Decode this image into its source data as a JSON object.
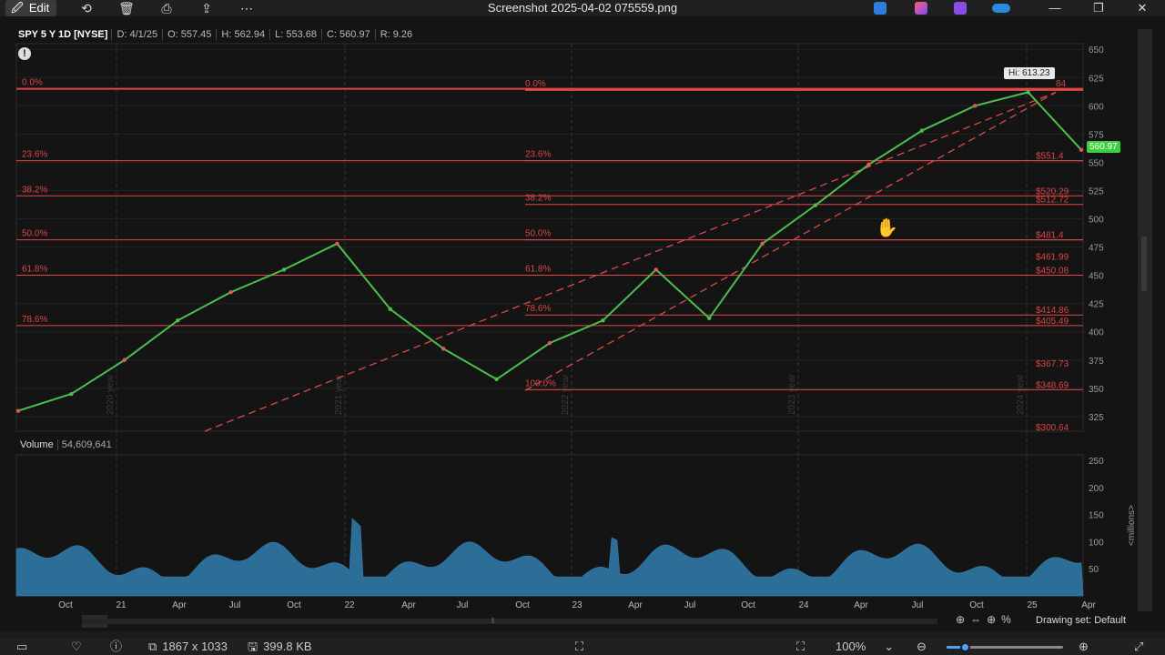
{
  "titlebar": {
    "edit_label": "Edit",
    "title": "Screenshot 2025-04-02 075559.png",
    "minimize": "—",
    "restore": "❐",
    "close": "✕"
  },
  "chart": {
    "header": {
      "symbol": "SPY 5 Y 1D [NYSE]",
      "date": "D: 4/1/25",
      "open": "O: 557.45",
      "high": "H: 562.94",
      "low": "L: 553.68",
      "close": "C: 560.97",
      "range": "R: 9.26"
    },
    "hi_tag": "Hi: 613.23",
    "last_tag": "560.97",
    "volume_label": "Volume",
    "volume_value": "54,609,641",
    "volume_unit_label": "<millions>",
    "price_ticks": [
      "650",
      "625",
      "600",
      "575",
      "550",
      "525",
      "500",
      "475",
      "450",
      "425",
      "400",
      "375",
      "350",
      "325"
    ],
    "volume_ticks": [
      "250",
      "200",
      "150",
      "100",
      "50"
    ],
    "x_ticks": [
      "Oct",
      "21",
      "Apr",
      "Jul",
      "Oct",
      "22",
      "Apr",
      "Jul",
      "Oct",
      "23",
      "Apr",
      "Jul",
      "Oct",
      "24",
      "Apr",
      "Jul",
      "Oct",
      "25",
      "Apr"
    ],
    "year_watermarks": [
      "2020 year",
      "2021 year",
      "2022 year",
      "2023 year",
      "2024 year"
    ],
    "fib_left_labels": [
      "0.0%",
      "23.6%",
      "38.2%",
      "50.0%",
      "61.8%",
      "78.6%"
    ],
    "fib_mid_labels": [
      "0.0%",
      "23.6%",
      "38.2%",
      "50.0%",
      "61.8%",
      "78.6%",
      "100.0%"
    ],
    "fib_right_labels": [
      "$551.4",
      "$520.29",
      "$512.72",
      "$481.4",
      "$461.99",
      "$450.08",
      "$414.86",
      "$405.49",
      "$367.73",
      "$348.69",
      "$300.64"
    ],
    "fib_right_partial": "84",
    "drawing_set": "Drawing set: Default",
    "alert_icon": "!"
  },
  "chart_data": {
    "type": "line",
    "title": "SPY 5 Y 1D [NYSE]",
    "xlabel": "",
    "ylabel": "",
    "ylim": [
      312,
      655
    ],
    "x": [
      "2020-08",
      "2020-10",
      "2021-01",
      "2021-04",
      "2021-07",
      "2021-10",
      "2022-01",
      "2022-04",
      "2022-07",
      "2022-10",
      "2023-01",
      "2023-04",
      "2023-07",
      "2023-10",
      "2024-01",
      "2024-04",
      "2024-07",
      "2024-10",
      "2025-01",
      "2025-02",
      "2025-04"
    ],
    "series": [
      {
        "values": [
          330,
          345,
          375,
          410,
          435,
          455,
          478,
          420,
          385,
          358,
          390,
          410,
          455,
          412,
          478,
          512,
          548,
          578,
          600,
          612,
          561
        ]
      }
    ],
    "volume_ylim": [
      0,
      260
    ],
    "volume_unit": "<millions>"
  },
  "statusbar": {
    "dimensions": "1867 x 1033",
    "file_size": "399.8 KB",
    "zoom": "100%",
    "zoom_level": 0.16
  }
}
